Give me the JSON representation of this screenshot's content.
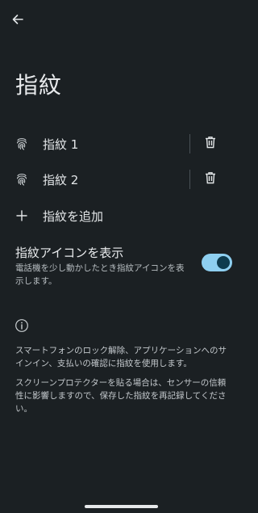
{
  "header": {
    "title": "指紋"
  },
  "icons": {
    "back": "arrow-left-icon",
    "fingerprint": "fingerprint-icon",
    "delete": "trash-icon",
    "add": "plus-icon",
    "info": "info-icon"
  },
  "fingerprints": [
    {
      "label": "指紋 1"
    },
    {
      "label": "指紋 2"
    }
  ],
  "add_fingerprint": {
    "label": "指紋を追加"
  },
  "show_icon_setting": {
    "title": "指紋アイコンを表示",
    "description": "電話機を少し動かしたとき指紋アイコンを表示します。",
    "enabled": true
  },
  "info": {
    "paragraph1": "スマートフォンのロック解除、アプリケーションへのサインイン、支払いの確認に指紋を使用します。",
    "paragraph2": "スクリーンプロテクターを貼る場合は、センサーの信頼性に影響しますので、保存した指紋を再記録してください。"
  },
  "colors": {
    "background": "#1b2023",
    "accent": "#8ecff0",
    "switch_knob": "#0e3b4e"
  }
}
